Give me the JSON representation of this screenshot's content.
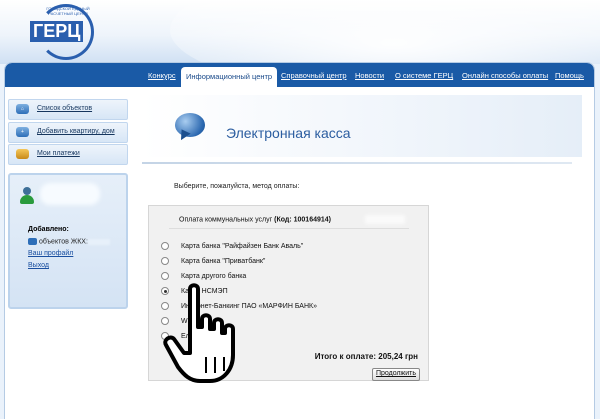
{
  "logo": {
    "text": "ГЕРЦ",
    "subtitle": "ГОРОДСКОЙ ЕДИНЫЙ РАСЧЕТНЫЙ ЦЕНТР"
  },
  "nav": {
    "items": [
      {
        "label": "Конкурс"
      },
      {
        "label": "Информационный центр"
      },
      {
        "label": "Справочный центр"
      },
      {
        "label": "Новости"
      },
      {
        "label": "О системе ГЕРЦ"
      },
      {
        "label": "Онлайн способы оплаты"
      },
      {
        "label": "Помощь"
      }
    ]
  },
  "sidebar": {
    "items": [
      {
        "label": "Список объектов",
        "icon": "house-icon"
      },
      {
        "label": "Добавить квартиру, дом",
        "icon": "add-house-icon"
      },
      {
        "label": "Мои платежи",
        "icon": "coins-icon"
      }
    ],
    "profile": {
      "added_label": "Добавлено:",
      "objects_label": "объектов ЖКХ:",
      "profile_link": "Ваш профайл",
      "logout_link": "Выход"
    }
  },
  "main": {
    "title": "Электронная касса",
    "prompt": "Выберите, пожалуйста, метод оплаты:",
    "panel": {
      "header_prefix": "Оплата коммунальных услуг",
      "header_code": "(Код: 100164914)",
      "options": [
        {
          "label": "Карта банка \"Райфайзен Банк Аваль\"",
          "selected": false
        },
        {
          "label": "Карта банка \"Приватбанк\"",
          "selected": false
        },
        {
          "label": "Карта другого банка",
          "selected": false
        },
        {
          "label": "Карта НСМЭП",
          "selected": true
        },
        {
          "label": "Интернет-Банкинг ПАО «МАРФИН БАНК»",
          "selected": false
        },
        {
          "label": "W",
          "selected": false
        },
        {
          "label": "Ел",
          "selected": false
        }
      ],
      "total_label": "Итого к оплате:",
      "total_value": "205,24 грн",
      "continue_button": "Продолжить"
    }
  },
  "colors": {
    "nav": "#1a5aa6",
    "accent": "#2b5da0",
    "link": "#1a4fa0"
  }
}
